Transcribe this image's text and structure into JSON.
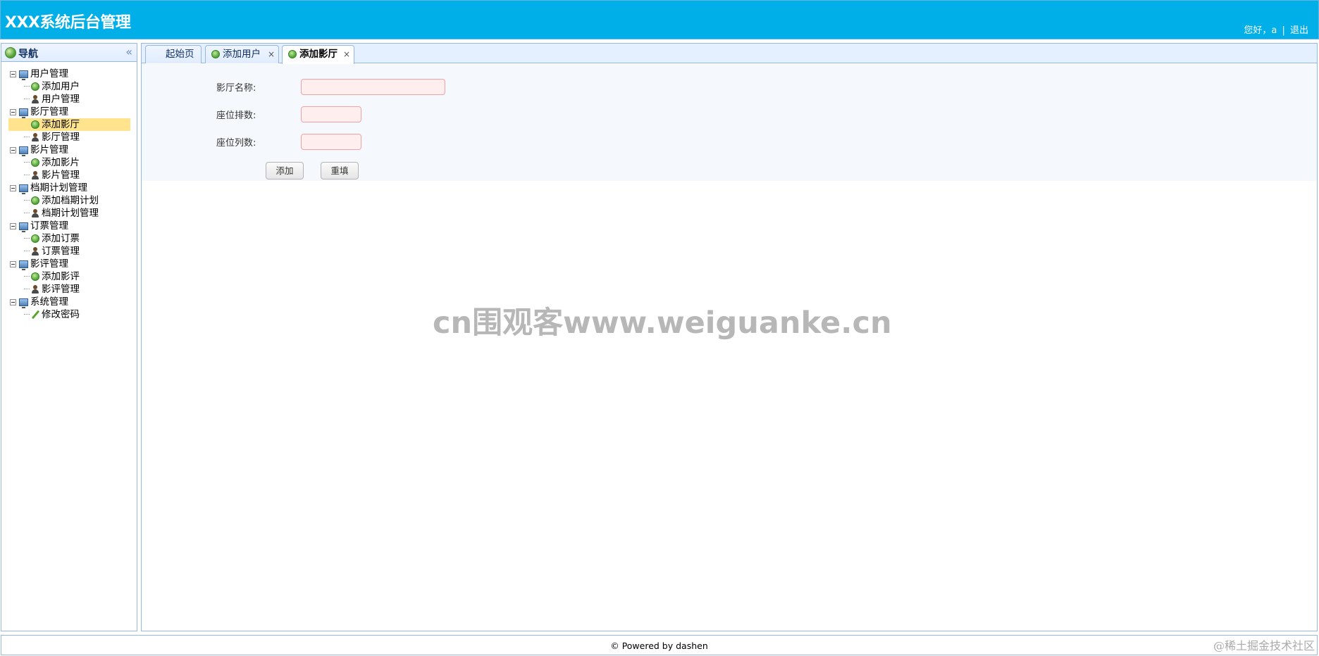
{
  "header": {
    "title": "XXX系统后台管理",
    "greeting": "您好，a",
    "separator": "|",
    "logout": "退出"
  },
  "nav": {
    "title": "导航",
    "collapse_icon": "«",
    "groups": [
      {
        "label": "用户管理",
        "children": [
          {
            "label": "添加用户",
            "icon": "add-icon"
          },
          {
            "label": "用户管理",
            "icon": "user-icon"
          }
        ]
      },
      {
        "label": "影厅管理",
        "children": [
          {
            "label": "添加影厅",
            "icon": "add-icon",
            "selected": true
          },
          {
            "label": "影厅管理",
            "icon": "user-icon"
          }
        ]
      },
      {
        "label": "影片管理",
        "children": [
          {
            "label": "添加影片",
            "icon": "add-icon"
          },
          {
            "label": "影片管理",
            "icon": "user-icon"
          }
        ]
      },
      {
        "label": "档期计划管理",
        "children": [
          {
            "label": "添加档期计划",
            "icon": "add-icon"
          },
          {
            "label": "档期计划管理",
            "icon": "user-icon"
          }
        ]
      },
      {
        "label": "订票管理",
        "children": [
          {
            "label": "添加订票",
            "icon": "add-icon"
          },
          {
            "label": "订票管理",
            "icon": "user-icon"
          }
        ]
      },
      {
        "label": "影评管理",
        "children": [
          {
            "label": "添加影评",
            "icon": "add-icon"
          },
          {
            "label": "影评管理",
            "icon": "user-icon"
          }
        ]
      },
      {
        "label": "系统管理",
        "children": [
          {
            "label": "修改密码",
            "icon": "pencil-icon"
          }
        ]
      }
    ]
  },
  "tabs": [
    {
      "label": "起始页",
      "closable": false
    },
    {
      "label": "添加用户",
      "closable": true
    },
    {
      "label": "添加影厅",
      "closable": true,
      "active": true
    }
  ],
  "tab_close_glyph": "×",
  "form": {
    "hall_name_label": "影厅名称:",
    "rows_label": "座位排数:",
    "cols_label": "座位列数:",
    "hall_name_value": "",
    "rows_value": "",
    "cols_value": "",
    "submit_label": "添加",
    "reset_label": "重填"
  },
  "watermark": "cn围观客www.weiguanke.cn",
  "footer": "© Powered by dashen",
  "corner_tag": "@稀土掘金技术社区"
}
